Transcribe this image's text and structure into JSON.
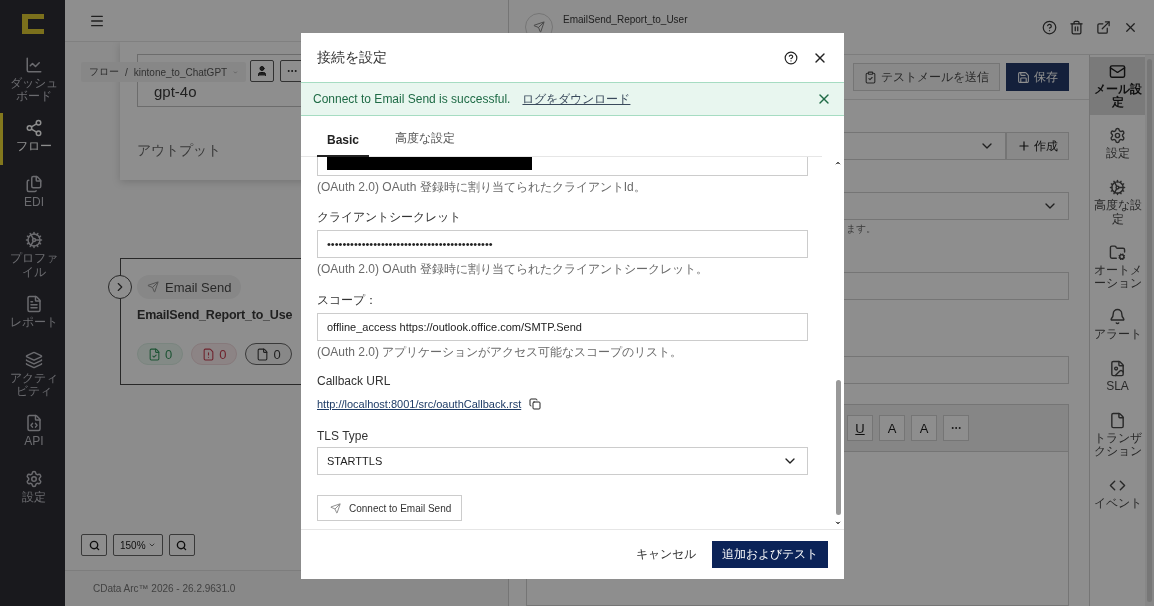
{
  "sidebar": {
    "items": [
      {
        "label": "ダッシュボード",
        "selected": false
      },
      {
        "label": "フロー",
        "selected": true
      },
      {
        "label": "EDI",
        "selected": false
      },
      {
        "label": "プロファイル",
        "selected": false
      },
      {
        "label": "レポート",
        "selected": false
      },
      {
        "label": "アクティビティ",
        "selected": false
      },
      {
        "label": "API",
        "selected": false
      },
      {
        "label": "設定",
        "selected": false
      }
    ]
  },
  "canvas": {
    "breadcrumb": [
      "フロー",
      "/",
      "kintone_to_ChatGPT"
    ],
    "model_field": "gpt-4o",
    "output_label": "アウトプット",
    "node": {
      "badge": "Email Send",
      "title": "EmailSend_Report_to_Use",
      "counts": [
        {
          "kind": "success",
          "count": "0"
        },
        {
          "kind": "error",
          "count": "0"
        },
        {
          "kind": "total",
          "count": "0"
        }
      ]
    },
    "zoom": "150%",
    "footer": "CData Arc™ 2026 - 26.2.9631.0"
  },
  "panel": {
    "title": "EmailSend_Report_to_User",
    "test_button": "テストメールを送信",
    "save_button": "保存",
    "create_button": "作成",
    "hint_fragment": "ます。",
    "format_buttons": [
      {
        "kind": "underline",
        "label": "U"
      },
      {
        "kind": "font-color",
        "label": "A"
      },
      {
        "kind": "highlight",
        "label": "A"
      },
      {
        "kind": "more"
      }
    ],
    "rail": [
      {
        "label": "メール設定",
        "selected": true
      },
      {
        "label": "設定",
        "selected": false
      },
      {
        "label": "高度な設定",
        "selected": false
      },
      {
        "label": "オートメーション",
        "selected": false
      },
      {
        "label": "アラート",
        "selected": false
      },
      {
        "label": "SLA",
        "selected": false
      },
      {
        "label": "トランザクション",
        "selected": false
      },
      {
        "label": "イベント",
        "selected": false
      }
    ]
  },
  "dialog": {
    "title": "接続を設定",
    "alert": {
      "message": "Connect to Email Send is successful.",
      "link": "ログをダウンロード"
    },
    "tabs": [
      {
        "label": "Basic",
        "selected": true
      },
      {
        "label": "高度な設定",
        "selected": false
      }
    ],
    "fields": [
      {
        "kind": "redacted",
        "hint": "(OAuth 2.0) OAuth 登録時に割り当てられたクライアントId。"
      },
      {
        "kind": "input",
        "label": "クライアントシークレット",
        "value": "•••••••••••••••••••••••••••••••••••••••••••",
        "hint": "(OAuth 2.0) OAuth 登録時に割り当てられたクライアントシークレット。"
      },
      {
        "kind": "input",
        "label": "スコープ：",
        "value": "offline_access https://outlook.office.com/SMTP.Send",
        "hint": "(OAuth 2.0) アプリケーションがアクセス可能なスコープのリスト。"
      },
      {
        "kind": "link",
        "label": "Callback URL",
        "value": "http://localhost:8001/src/oauthCallback.rst"
      },
      {
        "kind": "select",
        "label": "TLS Type",
        "value": "STARTTLS"
      }
    ],
    "connect_button": "Connect to Email Send",
    "cancel": "キャンセル",
    "submit": "追加およびテスト"
  }
}
